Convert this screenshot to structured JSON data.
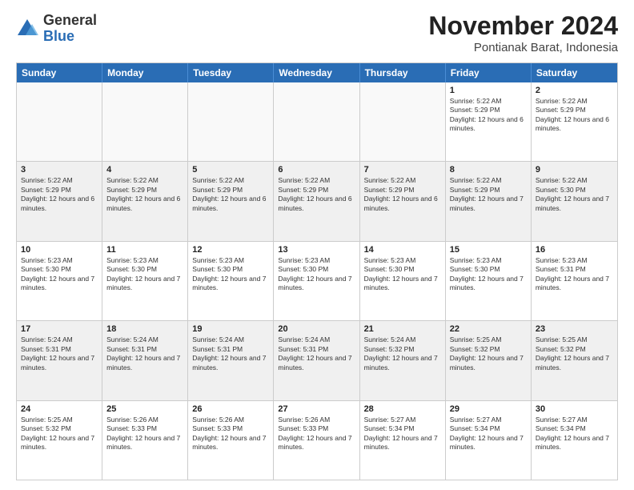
{
  "logo": {
    "general": "General",
    "blue": "Blue"
  },
  "header": {
    "month": "November 2024",
    "location": "Pontianak Barat, Indonesia"
  },
  "days": [
    "Sunday",
    "Monday",
    "Tuesday",
    "Wednesday",
    "Thursday",
    "Friday",
    "Saturday"
  ],
  "rows": [
    [
      {
        "day": "",
        "empty": true
      },
      {
        "day": "",
        "empty": true
      },
      {
        "day": "",
        "empty": true
      },
      {
        "day": "",
        "empty": true
      },
      {
        "day": "",
        "empty": true
      },
      {
        "day": "1",
        "sr": "Sunrise: 5:22 AM",
        "ss": "Sunset: 5:29 PM",
        "dl": "Daylight: 12 hours and 6 minutes."
      },
      {
        "day": "2",
        "sr": "Sunrise: 5:22 AM",
        "ss": "Sunset: 5:29 PM",
        "dl": "Daylight: 12 hours and 6 minutes."
      }
    ],
    [
      {
        "day": "3",
        "sr": "Sunrise: 5:22 AM",
        "ss": "Sunset: 5:29 PM",
        "dl": "Daylight: 12 hours and 6 minutes."
      },
      {
        "day": "4",
        "sr": "Sunrise: 5:22 AM",
        "ss": "Sunset: 5:29 PM",
        "dl": "Daylight: 12 hours and 6 minutes."
      },
      {
        "day": "5",
        "sr": "Sunrise: 5:22 AM",
        "ss": "Sunset: 5:29 PM",
        "dl": "Daylight: 12 hours and 6 minutes."
      },
      {
        "day": "6",
        "sr": "Sunrise: 5:22 AM",
        "ss": "Sunset: 5:29 PM",
        "dl": "Daylight: 12 hours and 6 minutes."
      },
      {
        "day": "7",
        "sr": "Sunrise: 5:22 AM",
        "ss": "Sunset: 5:29 PM",
        "dl": "Daylight: 12 hours and 6 minutes."
      },
      {
        "day": "8",
        "sr": "Sunrise: 5:22 AM",
        "ss": "Sunset: 5:29 PM",
        "dl": "Daylight: 12 hours and 7 minutes."
      },
      {
        "day": "9",
        "sr": "Sunrise: 5:22 AM",
        "ss": "Sunset: 5:30 PM",
        "dl": "Daylight: 12 hours and 7 minutes."
      }
    ],
    [
      {
        "day": "10",
        "sr": "Sunrise: 5:23 AM",
        "ss": "Sunset: 5:30 PM",
        "dl": "Daylight: 12 hours and 7 minutes."
      },
      {
        "day": "11",
        "sr": "Sunrise: 5:23 AM",
        "ss": "Sunset: 5:30 PM",
        "dl": "Daylight: 12 hours and 7 minutes."
      },
      {
        "day": "12",
        "sr": "Sunrise: 5:23 AM",
        "ss": "Sunset: 5:30 PM",
        "dl": "Daylight: 12 hours and 7 minutes."
      },
      {
        "day": "13",
        "sr": "Sunrise: 5:23 AM",
        "ss": "Sunset: 5:30 PM",
        "dl": "Daylight: 12 hours and 7 minutes."
      },
      {
        "day": "14",
        "sr": "Sunrise: 5:23 AM",
        "ss": "Sunset: 5:30 PM",
        "dl": "Daylight: 12 hours and 7 minutes."
      },
      {
        "day": "15",
        "sr": "Sunrise: 5:23 AM",
        "ss": "Sunset: 5:30 PM",
        "dl": "Daylight: 12 hours and 7 minutes."
      },
      {
        "day": "16",
        "sr": "Sunrise: 5:23 AM",
        "ss": "Sunset: 5:31 PM",
        "dl": "Daylight: 12 hours and 7 minutes."
      }
    ],
    [
      {
        "day": "17",
        "sr": "Sunrise: 5:24 AM",
        "ss": "Sunset: 5:31 PM",
        "dl": "Daylight: 12 hours and 7 minutes."
      },
      {
        "day": "18",
        "sr": "Sunrise: 5:24 AM",
        "ss": "Sunset: 5:31 PM",
        "dl": "Daylight: 12 hours and 7 minutes."
      },
      {
        "day": "19",
        "sr": "Sunrise: 5:24 AM",
        "ss": "Sunset: 5:31 PM",
        "dl": "Daylight: 12 hours and 7 minutes."
      },
      {
        "day": "20",
        "sr": "Sunrise: 5:24 AM",
        "ss": "Sunset: 5:31 PM",
        "dl": "Daylight: 12 hours and 7 minutes."
      },
      {
        "day": "21",
        "sr": "Sunrise: 5:24 AM",
        "ss": "Sunset: 5:32 PM",
        "dl": "Daylight: 12 hours and 7 minutes."
      },
      {
        "day": "22",
        "sr": "Sunrise: 5:25 AM",
        "ss": "Sunset: 5:32 PM",
        "dl": "Daylight: 12 hours and 7 minutes."
      },
      {
        "day": "23",
        "sr": "Sunrise: 5:25 AM",
        "ss": "Sunset: 5:32 PM",
        "dl": "Daylight: 12 hours and 7 minutes."
      }
    ],
    [
      {
        "day": "24",
        "sr": "Sunrise: 5:25 AM",
        "ss": "Sunset: 5:32 PM",
        "dl": "Daylight: 12 hours and 7 minutes."
      },
      {
        "day": "25",
        "sr": "Sunrise: 5:26 AM",
        "ss": "Sunset: 5:33 PM",
        "dl": "Daylight: 12 hours and 7 minutes."
      },
      {
        "day": "26",
        "sr": "Sunrise: 5:26 AM",
        "ss": "Sunset: 5:33 PM",
        "dl": "Daylight: 12 hours and 7 minutes."
      },
      {
        "day": "27",
        "sr": "Sunrise: 5:26 AM",
        "ss": "Sunset: 5:33 PM",
        "dl": "Daylight: 12 hours and 7 minutes."
      },
      {
        "day": "28",
        "sr": "Sunrise: 5:27 AM",
        "ss": "Sunset: 5:34 PM",
        "dl": "Daylight: 12 hours and 7 minutes."
      },
      {
        "day": "29",
        "sr": "Sunrise: 5:27 AM",
        "ss": "Sunset: 5:34 PM",
        "dl": "Daylight: 12 hours and 7 minutes."
      },
      {
        "day": "30",
        "sr": "Sunrise: 5:27 AM",
        "ss": "Sunset: 5:34 PM",
        "dl": "Daylight: 12 hours and 7 minutes."
      }
    ]
  ]
}
